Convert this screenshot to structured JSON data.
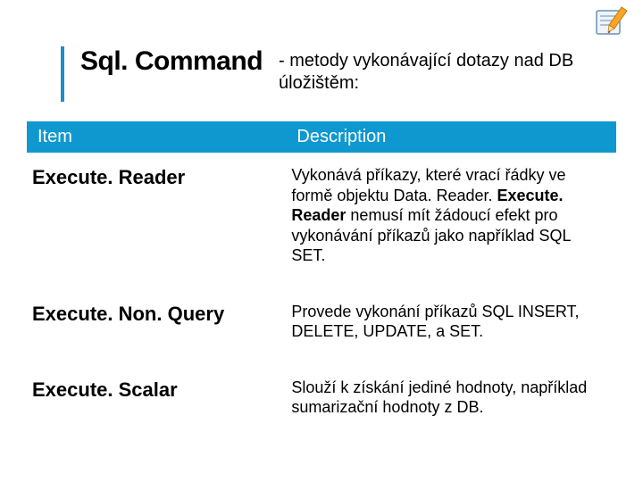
{
  "title": {
    "main": "Sql. Command",
    "sub": " - metody vykonávající dotazy nad DB úložištěm:"
  },
  "table": {
    "headers": {
      "item": "Item",
      "desc": "Description"
    },
    "rows": [
      {
        "item": "Execute. Reader",
        "desc_pre": "Vykonává příkazy, které vrací řádky ve formě objektu Data. Reader. ",
        "desc_bold": "Execute. Reader",
        "desc_post": " nemusí mít žádoucí efekt pro vykonávání příkazů jako například SQL SET."
      },
      {
        "item": "Execute. Non. Query",
        "desc_pre": "Provede vykonání příkazů SQL INSERT, DELETE, UPDATE, a SET.",
        "desc_bold": "",
        "desc_post": ""
      },
      {
        "item": "Execute. Scalar",
        "desc_pre": "Slouží k získání jediné hodnoty, například sumarizační hodnoty z DB.",
        "desc_bold": "",
        "desc_post": ""
      }
    ]
  },
  "icon": {
    "name": "notepad-pencil-icon"
  }
}
